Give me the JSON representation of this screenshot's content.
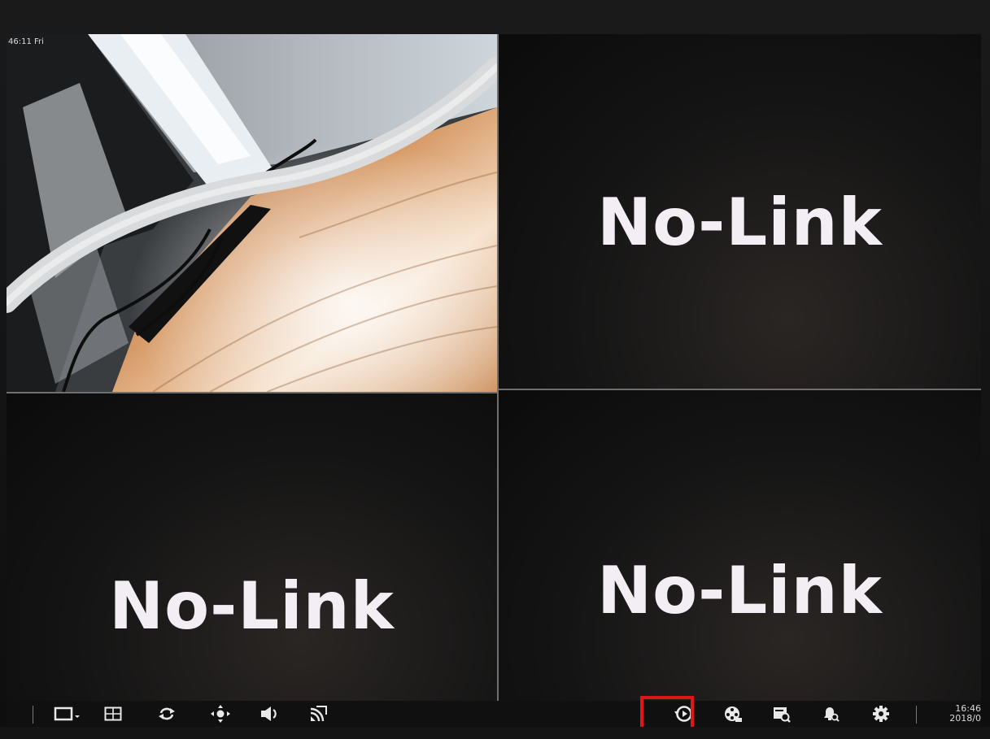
{
  "camera": {
    "channel1_osd_time": "46:11 Fri"
  },
  "channels": [
    {
      "id": 1,
      "status": "live"
    },
    {
      "id": 2,
      "status": "No-Link"
    },
    {
      "id": 3,
      "status": "No-Link"
    },
    {
      "id": 4,
      "status": "No-Link"
    }
  ],
  "toolbar": {
    "left_icons": [
      "single-view-icon",
      "quad-view-icon",
      "sequence-icon",
      "ptz-icon",
      "audio-icon",
      "cast-icon"
    ],
    "right_icons": [
      "playback-icon",
      "backup-icon",
      "search-icon",
      "alarm-search-icon",
      "settings-icon"
    ],
    "highlighted": "playback-icon",
    "clock_time": "16:46",
    "clock_date": "2018/0"
  },
  "colors": {
    "highlight": "#e0151c",
    "nolink_text": "#f2eef4",
    "icon": "#e8e8e8",
    "divider": "#6f6f6f"
  }
}
